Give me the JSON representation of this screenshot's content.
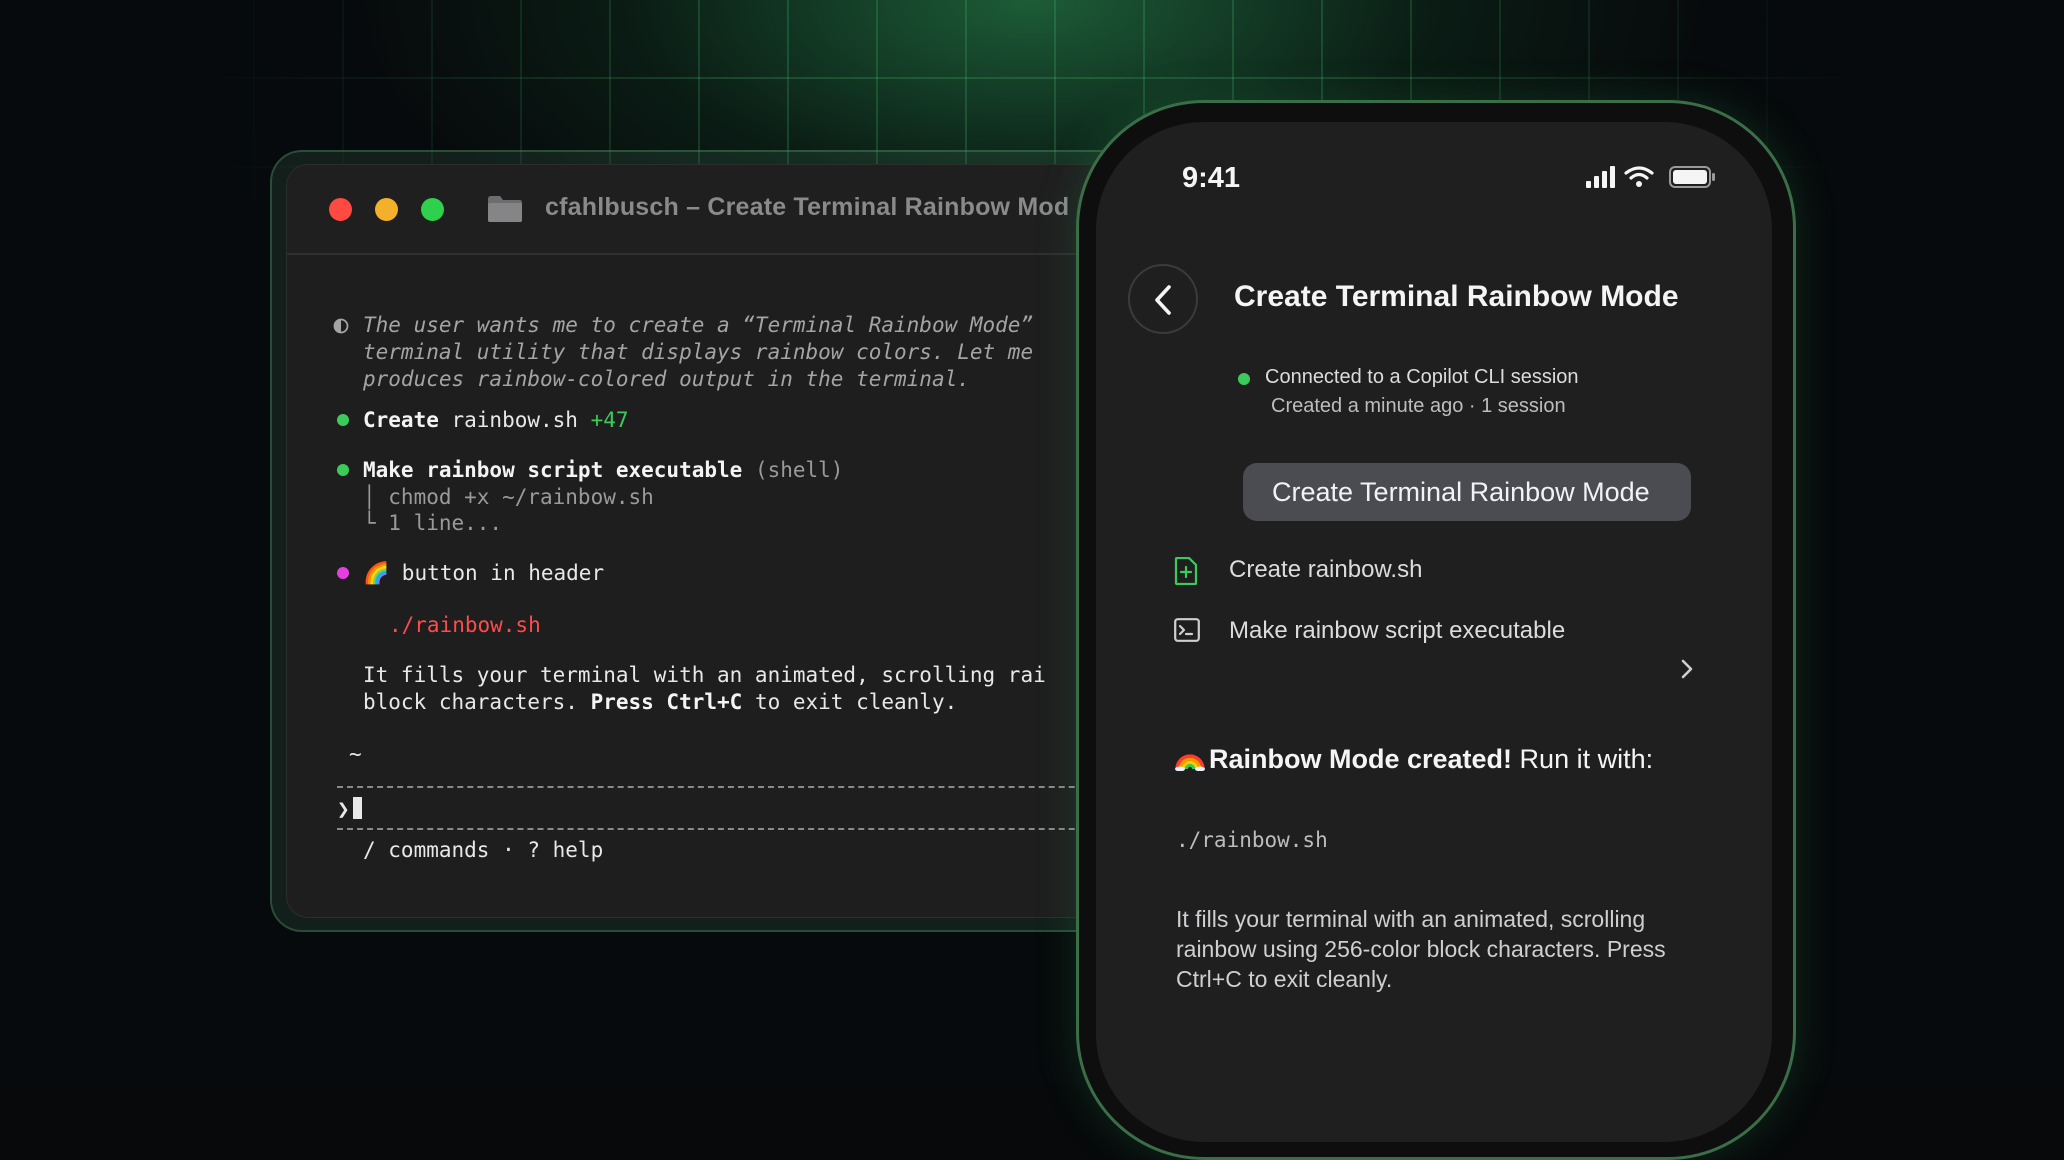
{
  "terminal": {
    "title": "cfahlbusch – Create Terminal Rainbow Mod",
    "thinking": [
      "The user wants me to create a “Terminal Rainbow Mode”",
      "terminal utility that displays rainbow colors. Let me",
      "produces rainbow-colored output in the terminal."
    ],
    "step1": {
      "action": "Create",
      "target": " rainbow.sh ",
      "diff": "+47"
    },
    "step2": {
      "action": "Make rainbow script executable",
      "tag": " (shell)",
      "cmd": "│ chmod +x ~/rainbow.sh",
      "more": "└ 1 line..."
    },
    "step3": {
      "emoji": "🌈",
      "text": " button in header"
    },
    "run_cmd": "./rainbow.sh",
    "desc_line1": "It fills your terminal with an animated, scrolling rai",
    "desc_line2a": "block characters. ",
    "desc_line2b": "Press Ctrl+C",
    "desc_line2c": " to exit cleanly.",
    "cwd": "~",
    "prompt": "❯",
    "footer": "/ commands · ? help",
    "colors": {
      "success": "#3ccb5a",
      "accent": "#e83de0",
      "error": "#ff4b4b"
    }
  },
  "phone": {
    "time": "9:41",
    "title": "Create Terminal Rainbow Mode",
    "connection": "Connected to a Copilot CLI session",
    "created": "Created a minute ago · 1 session",
    "chip": "Create Terminal Rainbow Mode",
    "actions": [
      {
        "icon": "file-plus-icon",
        "label": "Create rainbow.sh"
      },
      {
        "icon": "terminal-icon",
        "label": "Make rainbow script executable"
      }
    ],
    "result_bold": "Rainbow Mode created!",
    "result_rest": " Run it with:",
    "cmd": "./rainbow.sh",
    "paragraph": "It fills your terminal with an animated, scrolling rainbow using 256-color block characters. Press Ctrl+C to exit cleanly."
  }
}
